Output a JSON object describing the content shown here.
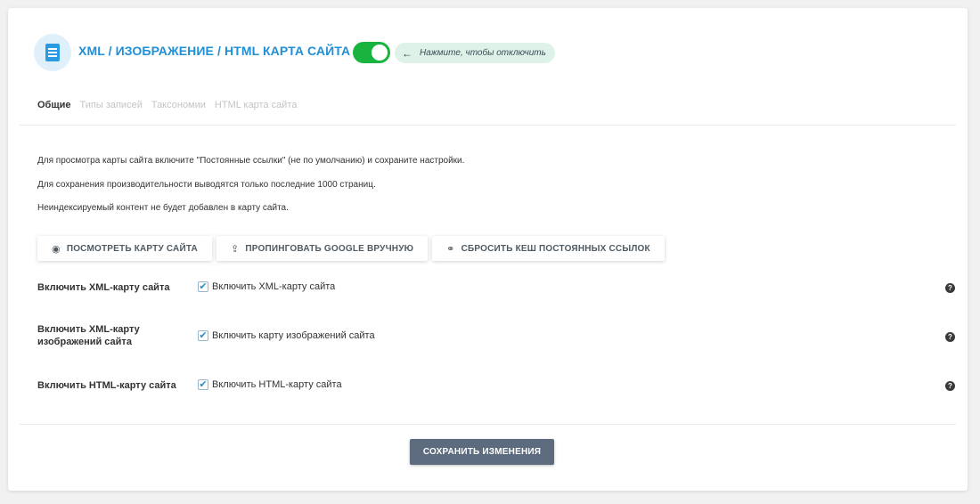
{
  "header": {
    "title": "XML / ИЗОБРАЖЕНИЕ / HTML КАРТА САЙТА",
    "toggle_on": true,
    "toggle_hint_arrow": "←",
    "toggle_hint": "Нажмите, чтобы отключить"
  },
  "tabs": [
    {
      "label": "Общие",
      "active": true
    },
    {
      "label": "Типы записей",
      "active": false
    },
    {
      "label": "Таксономии",
      "active": false
    },
    {
      "label": "HTML карта сайта",
      "active": false
    }
  ],
  "info": [
    "Для просмотра карты сайта включите \"Постоянные ссылки\" (не по умолчанию) и сохраните настройки.",
    "Для сохранения производительности выводятся только последние 1000 страниц.",
    "Неиндексируемый контент не будет добавлен в карту сайта."
  ],
  "actions": [
    {
      "icon": "eye-icon",
      "glyph": "◉",
      "label": "ПОСМОТРЕТЬ КАРТУ САЙТА"
    },
    {
      "icon": "share-icon",
      "glyph": "⇪",
      "label": "ПРОПИНГОВАТЬ GOOGLE ВРУЧНУЮ"
    },
    {
      "icon": "link-icon",
      "glyph": "⚭",
      "label": "СБРОСИТЬ КЕШ ПОСТОЯННЫХ ССЫЛОК"
    }
  ],
  "settings": [
    {
      "label": "Включить XML-карту сайта",
      "checkbox_label": "Включить XML-карту сайта",
      "checked": true
    },
    {
      "label": "Включить XML-карту изображений сайта",
      "checkbox_label": "Включить карту изображений сайта",
      "checked": true
    },
    {
      "label": "Включить HTML-карту сайта",
      "checkbox_label": "Включить HTML-карту сайта",
      "checked": true
    }
  ],
  "check_glyph": "✔",
  "help_glyph": "?",
  "save_label": "СОХРАНИТЬ ИЗМЕНЕНИЯ",
  "colors": {
    "accent": "#1f8fd6",
    "toggle": "#19b33f",
    "save_button": "#5c6b7e"
  }
}
